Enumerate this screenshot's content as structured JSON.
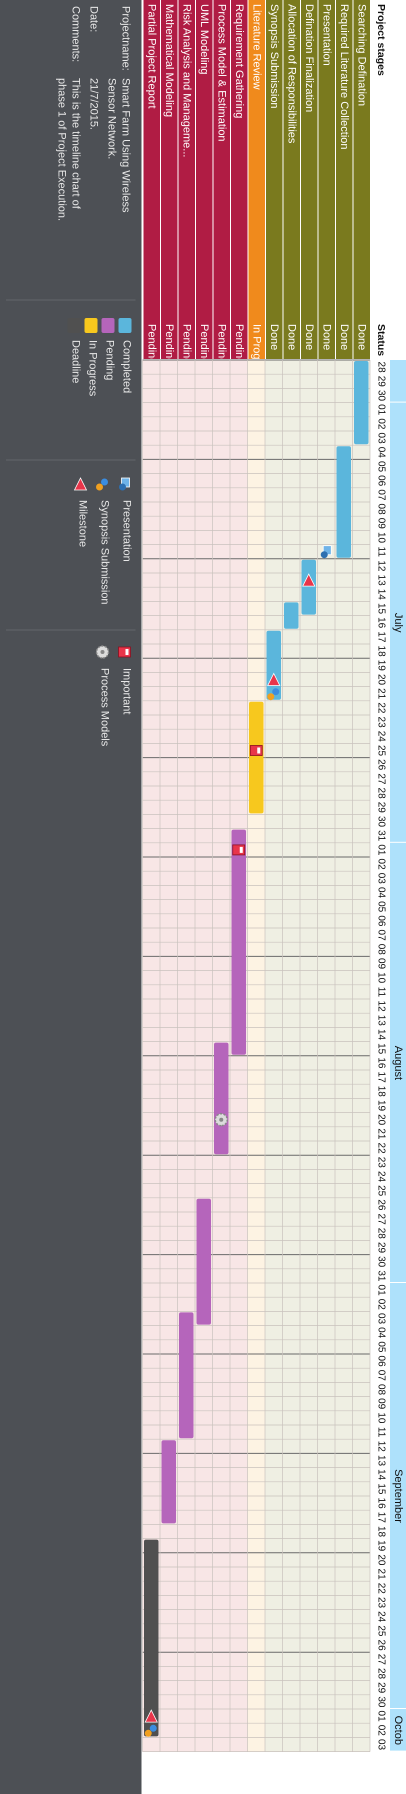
{
  "columns": {
    "stage": "Project stages",
    "status": "Status"
  },
  "chart_data": {
    "type": "gantt",
    "timeline_start": "2015-06-28",
    "timeline_end": "2015-10-03",
    "months": [
      "July",
      "August",
      "September",
      "Octob"
    ],
    "tasks": [
      {
        "name": "Searching Defination",
        "status": "Done",
        "group": "done",
        "start": "2015-06-28",
        "end": "2015-07-03"
      },
      {
        "name": "Required Literature Collection",
        "status": "Done",
        "group": "done",
        "start": "2015-07-04",
        "end": "2015-07-11"
      },
      {
        "name": "Presentation",
        "status": "Done",
        "group": "done",
        "start": "",
        "end": ""
      },
      {
        "name": "Defination Finalization",
        "status": "Done",
        "group": "done",
        "start": "2015-07-12",
        "end": "2015-07-15"
      },
      {
        "name": "Allocation of Responsibilities",
        "status": "Done",
        "group": "done",
        "start": "2015-07-15",
        "end": "2015-07-16"
      },
      {
        "name": "Synopsis Submission",
        "status": "Done",
        "group": "done",
        "start": "2015-07-17",
        "end": "2015-07-21"
      },
      {
        "name": "Literature Review",
        "status": "In Progress",
        "group": "progress",
        "start": "2015-07-22",
        "end": "2015-07-29"
      },
      {
        "name": "Requirement Gathering",
        "status": "Pending",
        "group": "pending",
        "start": "2015-07-31",
        "end": "2015-08-15"
      },
      {
        "name": "Process Model & Estimation",
        "status": "Pending",
        "group": "pending",
        "start": "2015-08-15",
        "end": "2015-08-22"
      },
      {
        "name": "UML Modeling",
        "status": "Pending",
        "group": "pending",
        "start": "2015-08-26",
        "end": "2015-09-03"
      },
      {
        "name": "Risk Analysis and Manageme...",
        "status": "Pending",
        "group": "pending",
        "start": "2015-09-03",
        "end": "2015-09-11"
      },
      {
        "name": "Mathematical Modeling",
        "status": "Pending",
        "group": "pending",
        "start": "2015-09-12",
        "end": "2015-09-17"
      },
      {
        "name": "Partial Project Report",
        "status": "Pending",
        "group": "deadline",
        "start": "2015-09-19",
        "end": "2015-10-02"
      }
    ],
    "markers": [
      {
        "row": 2,
        "date": "2015-07-11",
        "icon": "presentation-icon"
      },
      {
        "row": 3,
        "date": "2015-07-13",
        "icon": "milestone-icon"
      },
      {
        "row": 5,
        "date": "2015-07-20",
        "icon": "milestone-icon"
      },
      {
        "row": 5,
        "date": "2015-07-21",
        "icon": "synopsis-submission-icon"
      },
      {
        "row": 6,
        "date": "2015-07-25",
        "icon": "important-icon"
      },
      {
        "row": 7,
        "date": "2015-08-01",
        "icon": "important-icon"
      },
      {
        "row": 8,
        "date": "2015-08-20",
        "icon": "process-models-icon"
      },
      {
        "row": 12,
        "date": "2015-10-01",
        "icon": "milestone-icon"
      },
      {
        "row": 12,
        "date": "2015-10-02",
        "icon": "synopsis-submission-icon"
      }
    ]
  },
  "colors": {
    "done_row": "#7a7a1e",
    "progress_row": "#f08a1c",
    "pending_row": "#b01c44",
    "bar_done": "#5bb6dc",
    "bar_progress": "#f7c81e",
    "bar_pending": "#b565bb",
    "bar_deadline": "#505050",
    "grid_done": "#efefe3",
    "grid_progress": "#fdf3e3",
    "grid_pending": "#f8e6e6",
    "month_band": "#aee1fb",
    "panel": "#4d5055"
  },
  "info": {
    "project_label": "Projectname:",
    "project_value": [
      "Smart Farm Using Wireless",
      "Sensor Network."
    ],
    "date_label": "Date:",
    "date_value": "21/7/2015.",
    "comments_label": "Comments:",
    "comments_value": [
      "This is the timeline chart of",
      "phase 1 of Project Execution."
    ]
  },
  "legend": {
    "status_items": [
      {
        "label": "Completed",
        "color": "#5bb6dc"
      },
      {
        "label": "Pending",
        "color": "#b565bb"
      },
      {
        "label": "In Progress",
        "color": "#f7c81e"
      },
      {
        "label": "Deadline",
        "color": "#505050"
      }
    ],
    "icon_items": [
      {
        "label": "Presentation",
        "icon": "presentation-icon"
      },
      {
        "label": "Synopsis Submission",
        "icon": "synopsis-submission-icon"
      },
      {
        "label": "Milestone",
        "icon": "milestone-icon"
      }
    ],
    "icon_items2": [
      {
        "label": "Important",
        "icon": "important-icon"
      },
      {
        "label": "Process Models",
        "icon": "process-models-icon"
      }
    ]
  }
}
